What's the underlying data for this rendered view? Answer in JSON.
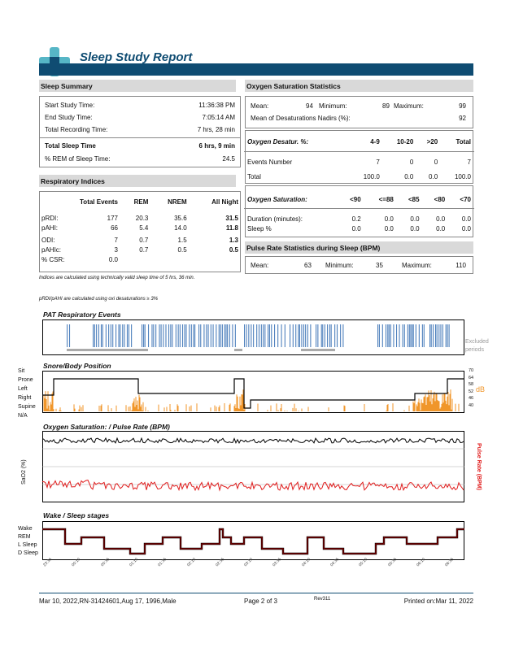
{
  "report": {
    "title": "Sleep Study Report"
  },
  "sleep_summary": {
    "heading": "Sleep Summary",
    "rows": [
      {
        "label": "Start Study Time:",
        "value": "11:36:38 PM"
      },
      {
        "label": "End Study Time:",
        "value": "7:05:14 AM"
      },
      {
        "label": "Total Recording Time:",
        "value": "7 hrs, 28 min"
      }
    ],
    "total_sleep_label": "Total Sleep Time",
    "total_sleep_value": "6 hrs, 9 min",
    "rem_label": "% REM of Sleep Time:",
    "rem_value": "24.5"
  },
  "resp": {
    "heading": "Respiratory Indices",
    "headers": [
      "",
      "Total Events",
      "REM",
      "NREM",
      "All Night"
    ],
    "rows": [
      [
        "pRDI:",
        "177",
        "20.3",
        "35.6",
        "31.5"
      ],
      [
        "pAHI:",
        "66",
        "5.4",
        "14.0",
        "11.8"
      ],
      [
        "ODI:",
        "7",
        "0.7",
        "1.5",
        "1.3"
      ],
      [
        "pAHIc:",
        "3",
        "0.7",
        "0.5",
        "0.5"
      ],
      [
        "% CSR:",
        "0.0",
        "",
        "",
        ""
      ]
    ],
    "note1": "Indices are calculated using technically valid sleep time of  5 hrs, 36 min.",
    "note2": "pRDI/pAHI are calculated using oxi desaturations ≥ 3%"
  },
  "oxy": {
    "heading": "Oxygen Saturation Statistics",
    "mean_label": "Mean:",
    "mean": "94",
    "min_label": "Minimum:",
    "min": "89",
    "max_label": "Maximum:",
    "max": "99",
    "nadir_label": "Mean of Desaturations Nadirs (%):",
    "nadir": "92",
    "desat_headers": [
      "Oxygen Desatur. %:",
      "4-9",
      "10-20",
      ">20",
      "Total"
    ],
    "desat_rows": [
      [
        "Events Number",
        "7",
        "0",
        "0",
        "7"
      ],
      [
        "Total",
        "100.0",
        "0.0",
        "0.0",
        "100.0"
      ]
    ],
    "sat_headers": [
      "Oxygen Saturation:",
      "<90",
      "<=88",
      "<85",
      "<80",
      "<70"
    ],
    "sat_rows": [
      [
        "Duration (minutes):",
        "0.2",
        "0.0",
        "0.0",
        "0.0",
        "0.0"
      ],
      [
        "Sleep %",
        "0.0",
        "0.0",
        "0.0",
        "0.0",
        "0.0"
      ]
    ]
  },
  "pulse": {
    "heading": "Pulse Rate Statistics during Sleep (BPM)",
    "mean_label": "Mean:",
    "mean": "63",
    "min_label": "Minimum:",
    "min": "35",
    "max_label": "Maximum:",
    "max": "110"
  },
  "charts": {
    "pat_title": "PAT  Respiratory Events",
    "excluded_label": "Excluded periods",
    "snore_title": "Snore/Body Position",
    "positions": [
      "Sit",
      "Prone",
      "Left",
      "Right",
      "Supine",
      "N/A"
    ],
    "db_ticks": [
      "70",
      "64",
      "58",
      "52",
      "46",
      "40"
    ],
    "db_label": "dB",
    "oxy_title": "Oxygen Saturation: / Pulse Rate (BPM)",
    "sao2_label": "SaO2 (%)",
    "pulse_label": "Pulse Rate (BPM)",
    "stages_title": "Wake / Sleep stages",
    "stages": [
      "Wake",
      "REM",
      "L Sleep",
      "D Sleep"
    ],
    "time_ticks": [
      "23:36",
      "00:10",
      "00:35",
      "01:10",
      "01:35",
      "02:10",
      "02:35",
      "03:10",
      "03:35",
      "04:10",
      "04:35",
      "05:10",
      "05:35",
      "06:10",
      "06:35"
    ]
  },
  "footer": {
    "left": "Mar 10, 2022,RN-31424601,Aug 17, 1996,Male",
    "center": "Page 2 of 3",
    "rev": "Rev311",
    "right": "Printed on:Mar 11, 2022"
  },
  "colors": {
    "brand": "#0f4c72",
    "logo_light": "#56b6c6",
    "events": "#4f81bd",
    "snore": "#f0962a",
    "pulse": "#e01b1b"
  }
}
